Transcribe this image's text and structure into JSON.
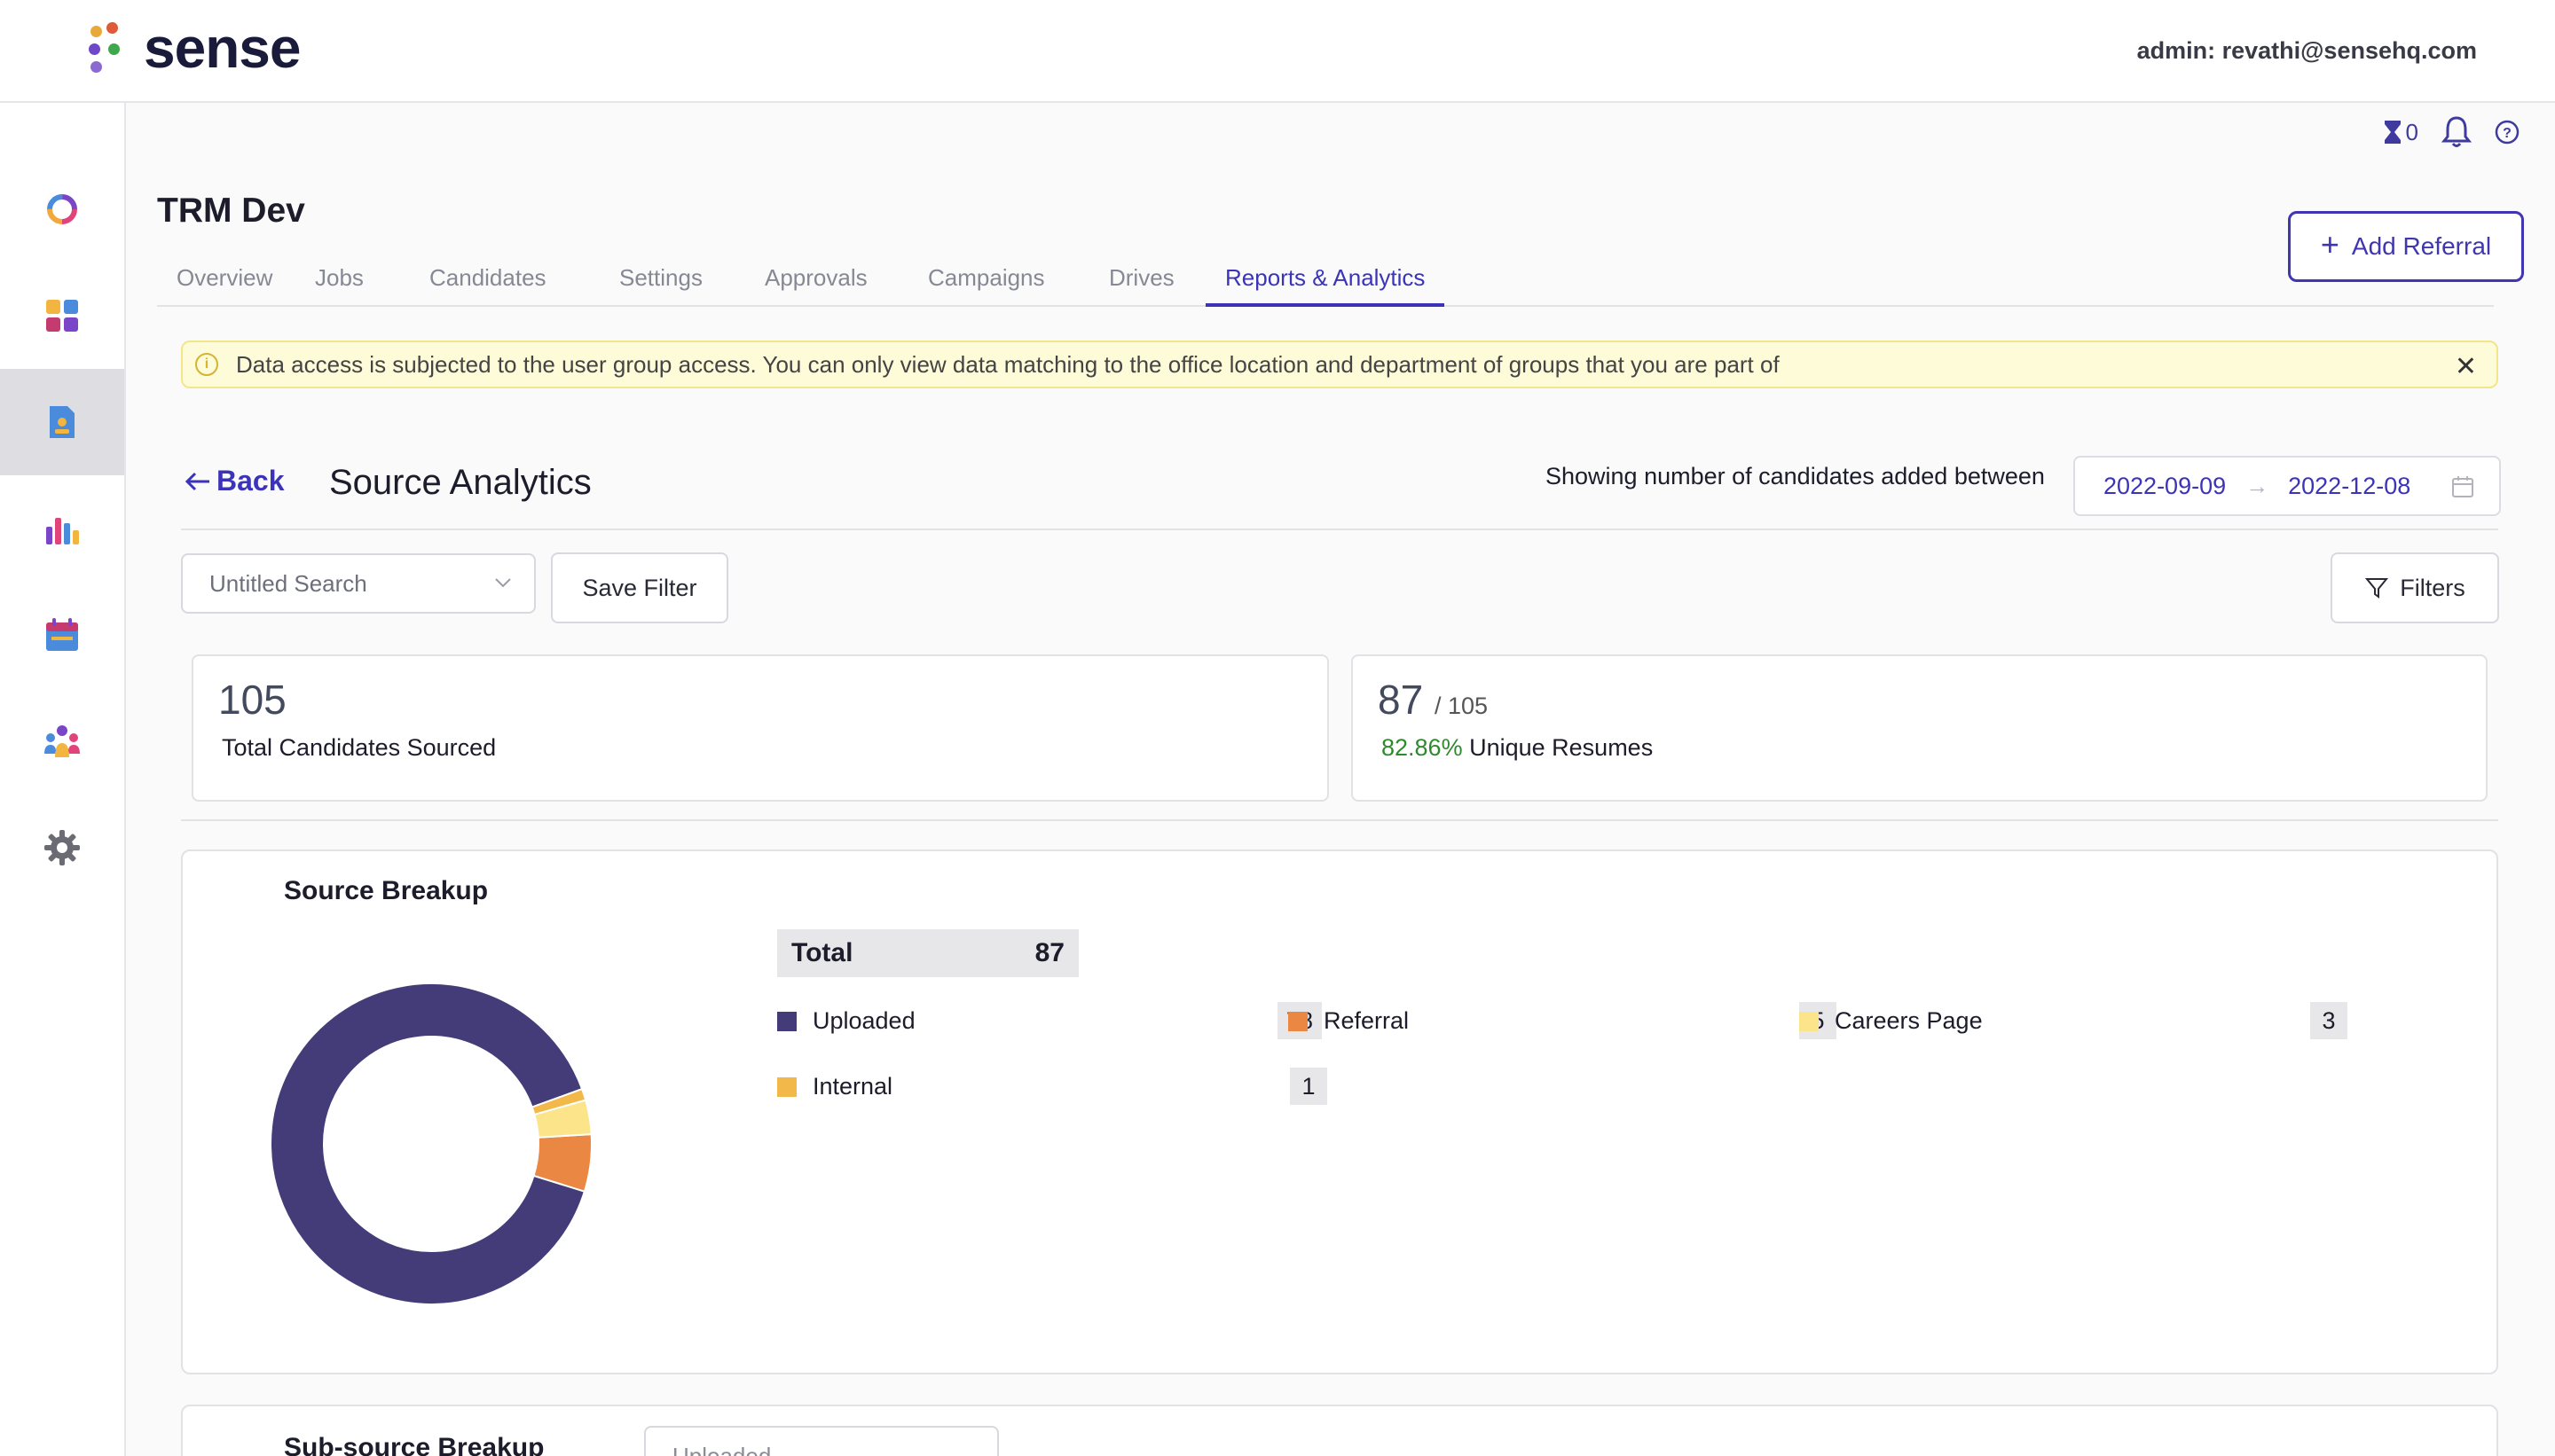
{
  "brand": {
    "name": "sense",
    "dot_colors": [
      "#e8a93a",
      "#e05a3a",
      "#6f47c9",
      "#3fa84d",
      "#8a6ad1"
    ]
  },
  "header": {
    "admin_label": "admin: revathi@sensehq.com"
  },
  "sidebar": {
    "items": [
      {
        "name": "dashboard-ring-icon"
      },
      {
        "name": "apps-grid-icon"
      },
      {
        "name": "document-icon",
        "active": true
      },
      {
        "name": "analytics-bars-icon"
      },
      {
        "name": "calendar-icon"
      },
      {
        "name": "people-icon"
      },
      {
        "name": "settings-gear-icon"
      }
    ]
  },
  "utility": {
    "hourglass_count": "0"
  },
  "page": {
    "title": "TRM Dev",
    "add_referral_label": "Add Referral",
    "tabs": [
      "Overview",
      "Jobs",
      "Candidates",
      "Settings",
      "Approvals",
      "Campaigns",
      "Drives",
      "Reports & Analytics"
    ],
    "active_tab": "Reports & Analytics"
  },
  "banner": {
    "text": "Data access is subjected to the user group access. You can only view data matching to the office location and department of groups that you are part of"
  },
  "analytics": {
    "back_label": "Back",
    "title": "Source Analytics",
    "showing_text": "Showing number of candidates added between",
    "date_from": "2022-09-09",
    "date_to": "2022-12-08",
    "search_value": "Untitled Search",
    "save_filter_label": "Save Filter",
    "filters_label": "Filters"
  },
  "stats": {
    "total_value": "105",
    "total_label": "Total Candidates Sourced",
    "unique_value": "87",
    "unique_of": "/ 105",
    "unique_pct": "82.86%",
    "unique_label": "Unique Resumes"
  },
  "source_breakup": {
    "title": "Source Breakup",
    "total_label": "Total",
    "total_value": "87"
  },
  "chart_data": {
    "type": "pie",
    "title": "Source Breakup",
    "categories": [
      "Uploaded",
      "Referral",
      "Careers Page",
      "Internal"
    ],
    "values": [
      78,
      5,
      3,
      1
    ],
    "colors": [
      "#433c78",
      "#ea8743",
      "#fbe489",
      "#f3b84a"
    ],
    "donut": true
  },
  "subsource": {
    "title": "Sub-source Breakup",
    "select_value": "Uploaded"
  }
}
